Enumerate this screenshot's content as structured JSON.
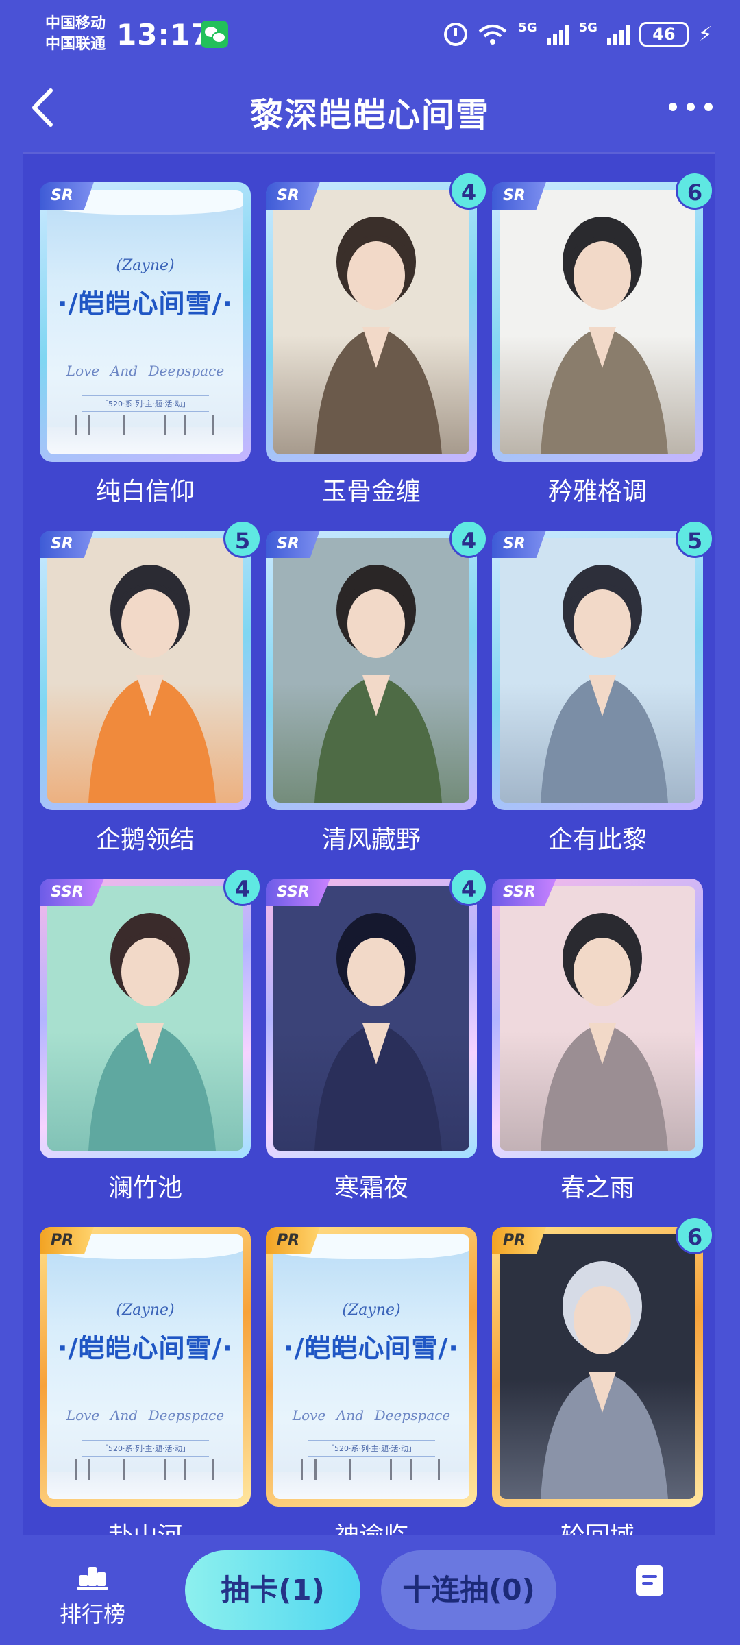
{
  "status_bar": {
    "carrier_1": "中国移动",
    "carrier_2": "中国联通",
    "time": "13:17",
    "wifi_label": "6",
    "net_1": "5G",
    "net_2": "5G",
    "battery": "46"
  },
  "header": {
    "title": "黎深皑皑心间雪"
  },
  "poster": {
    "subtitle": "(Zayne)",
    "title": "·/皑皑心间雪/·",
    "script": [
      "Love",
      "And",
      "Deepspace"
    ],
    "series": "「520·系·列·主·题·活·动」"
  },
  "cards": [
    {
      "name": "纯白信仰",
      "rarity": "SR",
      "count": "",
      "art": "poster"
    },
    {
      "name": "玉骨金缠",
      "rarity": "SR",
      "count": "4",
      "art": "portrait"
    },
    {
      "name": "矜雅格调",
      "rarity": "SR",
      "count": "6",
      "art": "portrait"
    },
    {
      "name": "企鹅领结",
      "rarity": "SR",
      "count": "5",
      "art": "portrait"
    },
    {
      "name": "清风藏野",
      "rarity": "SR",
      "count": "4",
      "art": "portrait"
    },
    {
      "name": "企有此黎",
      "rarity": "SR",
      "count": "5",
      "art": "portrait"
    },
    {
      "name": "澜竹池",
      "rarity": "SSR",
      "count": "4",
      "art": "portrait"
    },
    {
      "name": "寒霜夜",
      "rarity": "SSR",
      "count": "4",
      "art": "portrait"
    },
    {
      "name": "春之雨",
      "rarity": "SSR",
      "count": "",
      "art": "portrait"
    },
    {
      "name": "赴山河",
      "rarity": "PR",
      "count": "",
      "art": "poster"
    },
    {
      "name": "神谕临",
      "rarity": "PR",
      "count": "",
      "art": "poster"
    },
    {
      "name": "轮回域",
      "rarity": "PR",
      "count": "6",
      "art": "portrait"
    }
  ],
  "bottom_bar": {
    "rank_label": "排行榜",
    "draw_label": "抽卡(1)",
    "draw10_label": "十连抽(0)"
  },
  "colors": {
    "background": "#4a52d6",
    "panel": "#4046cf",
    "badge": "#5fe8e2",
    "draw_button": "#4fd6f0"
  }
}
